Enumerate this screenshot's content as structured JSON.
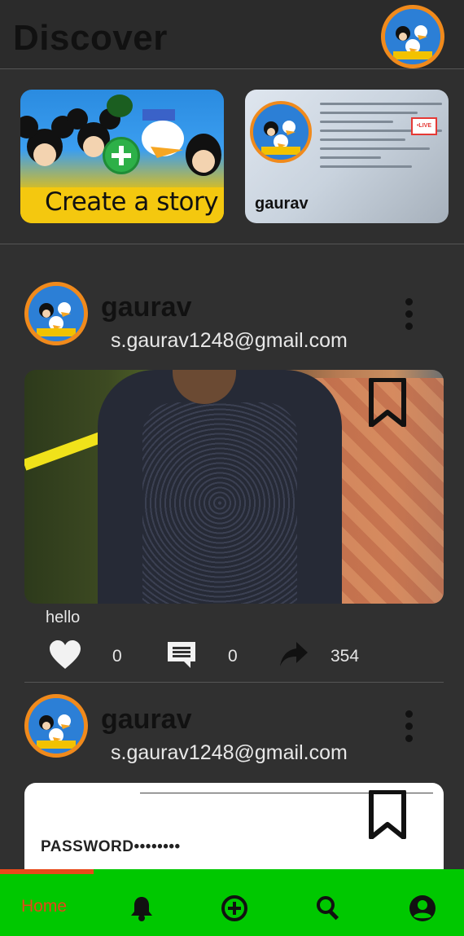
{
  "header": {
    "title": "Discover"
  },
  "stories": {
    "create_label": "Create a story",
    "live_user": "gaurav",
    "live_badge": "•LIVE"
  },
  "posts": [
    {
      "user": "gaurav",
      "email": "s.gaurav1248@gmail.com",
      "caption": "hello",
      "likes": "0",
      "comments": "0",
      "shares": "354"
    },
    {
      "user": "gaurav",
      "email": "s.gaurav1248@gmail.com",
      "card_text": "PASSWORD••••••••"
    }
  ],
  "nav": {
    "home_label": "Home",
    "items": [
      "notifications-icon",
      "add-icon",
      "search-icon",
      "profile-icon"
    ],
    "active_color": "#e8451a",
    "bg_color": "#00c800"
  },
  "colors": {
    "accent_ring": "#f08a1c",
    "background": "#303030"
  }
}
